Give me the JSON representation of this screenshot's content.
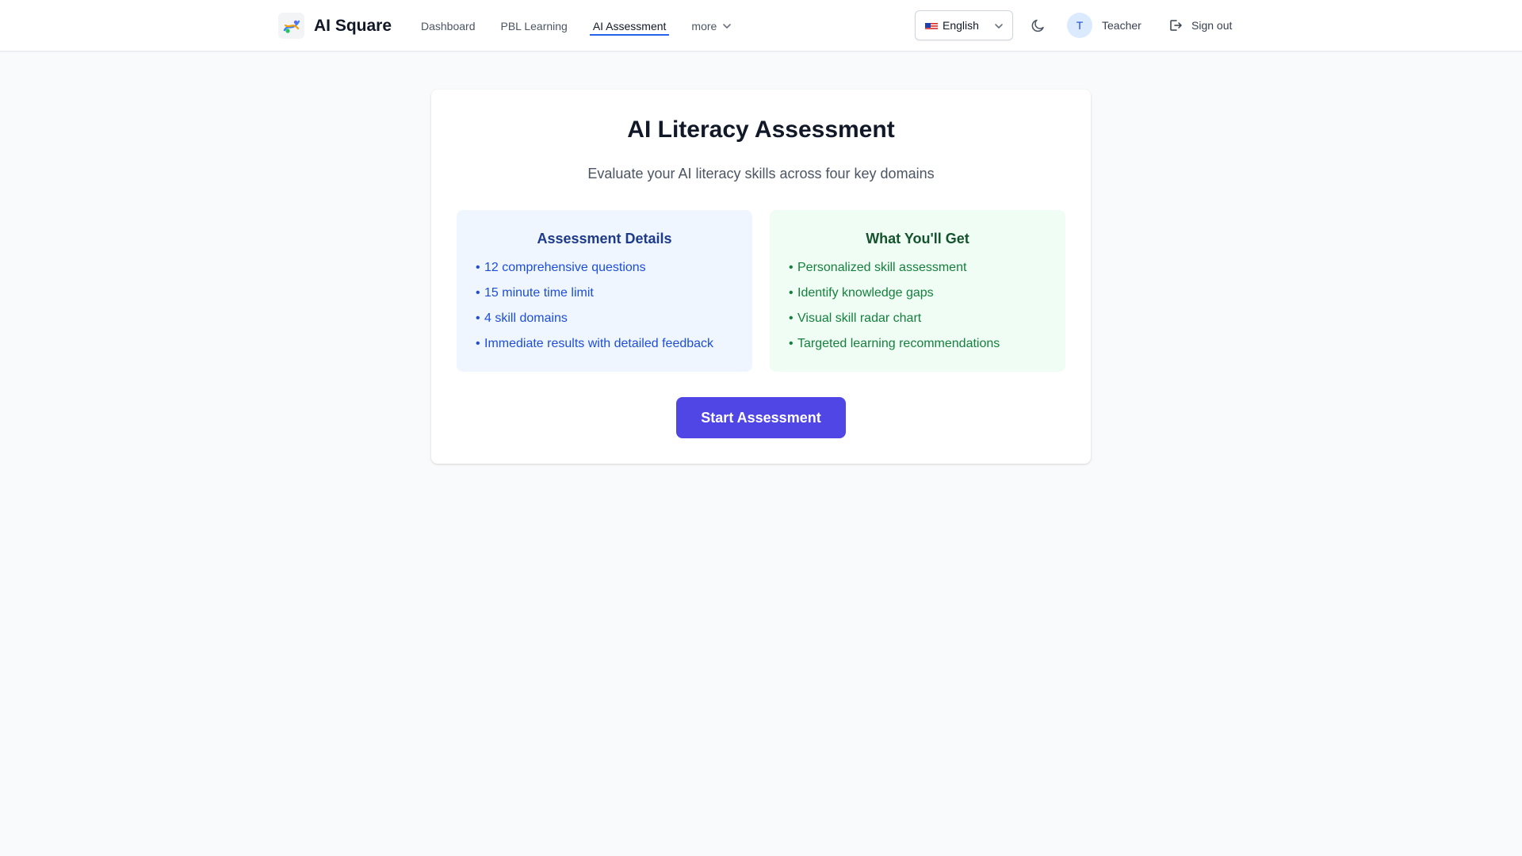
{
  "header": {
    "brand": "AI Square",
    "nav": {
      "dashboard": "Dashboard",
      "pbl": "PBL Learning",
      "assessment": "AI Assessment",
      "more": "more"
    },
    "language": "English",
    "user_initial": "T",
    "user_name": "Teacher",
    "signout": "Sign out",
    "icons": {
      "logo": "ai-square-logo-icon",
      "flag": "us-flag-icon",
      "lang_chevron": "chevron-down-icon",
      "more_chevron": "chevron-down-icon",
      "theme": "moon-icon",
      "signout": "logout-icon"
    }
  },
  "main": {
    "title": "AI Literacy Assessment",
    "subtitle": "Evaluate your AI literacy skills across four key domains",
    "details": {
      "title": "Assessment Details",
      "items": [
        "12 comprehensive questions",
        "15 minute time limit",
        "4 skill domains",
        "Immediate results with detailed feedback"
      ]
    },
    "benefits": {
      "title": "What You'll Get",
      "items": [
        "Personalized skill assessment",
        "Identify knowledge gaps",
        "Visual skill radar chart",
        "Targeted learning recommendations"
      ]
    },
    "start_button": "Start Assessment"
  },
  "colors": {
    "accent": "#4f46e5",
    "nav_underline": "#2563eb",
    "details_bg": "#eff6ff",
    "details_text": "#1d4ed8",
    "benefits_bg": "#f0fdf4",
    "benefits_text": "#15803d"
  }
}
